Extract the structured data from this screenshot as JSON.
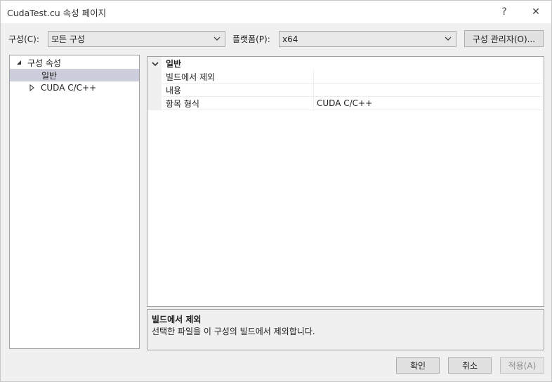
{
  "window": {
    "title": "CudaTest.cu 속성 페이지",
    "help_label": "?",
    "close_label": "✕"
  },
  "toolbar": {
    "config_label": "구성(C):",
    "config_value": "모든 구성",
    "platform_label": "플랫폼(P):",
    "platform_value": "x64",
    "config_manager_label": "구성 관리자(O)..."
  },
  "tree": {
    "items": [
      {
        "label": "구성 속성",
        "expanded": true
      },
      {
        "label": "일반",
        "selected": true
      },
      {
        "label": "CUDA C/C++",
        "expanded": false
      }
    ]
  },
  "grid": {
    "category": "일반",
    "properties": [
      {
        "name": "빌드에서 제외",
        "value": ""
      },
      {
        "name": "내용",
        "value": ""
      },
      {
        "name": "항목 형식",
        "value": "CUDA C/C++"
      }
    ]
  },
  "description": {
    "title": "빌드에서 제외",
    "text": "선택한 파일을 이 구성의 빌드에서 제외합니다."
  },
  "buttons": {
    "ok": "확인",
    "cancel": "취소",
    "apply": "적용(A)"
  }
}
